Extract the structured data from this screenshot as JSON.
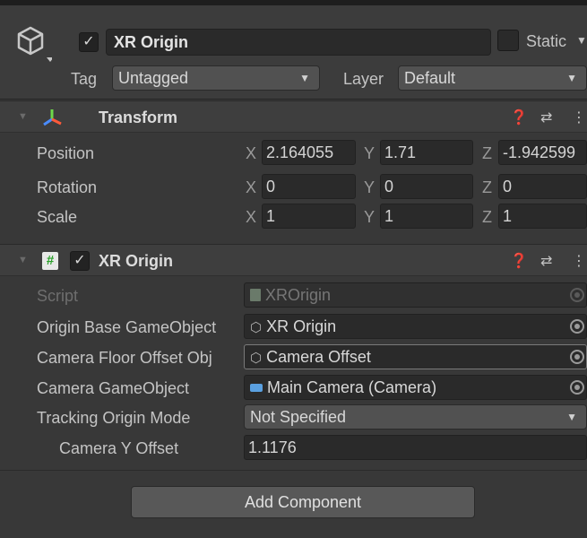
{
  "gameobject": {
    "active_check": "✓",
    "name": "XR Origin",
    "static_label": "Static",
    "tag_label": "Tag",
    "tag_value": "Untagged",
    "layer_label": "Layer",
    "layer_value": "Default"
  },
  "transform": {
    "title": "Transform",
    "position": {
      "label": "Position",
      "x": "2.164055",
      "y": "1.71",
      "z": "-1.942599"
    },
    "rotation": {
      "label": "Rotation",
      "x": "0",
      "y": "0",
      "z": "0"
    },
    "scale": {
      "label": "Scale",
      "x": "1",
      "y": "1",
      "z": "1"
    },
    "axis": {
      "x": "X",
      "y": "Y",
      "z": "Z"
    }
  },
  "xr_origin": {
    "title": "XR Origin",
    "enabled_check": "✓",
    "script_icon": "#",
    "fields": {
      "script": {
        "label": "Script",
        "value": "XROrigin"
      },
      "origin_base": {
        "label": "Origin Base GameObject",
        "value": "XR Origin"
      },
      "camera_floor_offset": {
        "label": "Camera Floor Offset Obj",
        "value": "Camera Offset"
      },
      "camera_gameobject": {
        "label": "Camera GameObject",
        "value": "Main Camera (Camera)"
      },
      "tracking_origin_mode": {
        "label": "Tracking Origin Mode",
        "value": "Not Specified"
      },
      "camera_y_offset": {
        "label": "Camera Y Offset",
        "value": "1.1176"
      }
    }
  },
  "icons": {
    "help": "help-icon",
    "presets": "presets-icon",
    "menu": "kebab-menu-icon",
    "gameobject": "cube-icon",
    "transform": "transform-axes-icon",
    "camera": "camera-icon",
    "object_ref": "gameobject-cube-icon"
  },
  "add_component": {
    "label": "Add Component"
  },
  "colors": {
    "background": "#383838",
    "field": "#2a2a2a",
    "accent_green": "#3fbf3f"
  }
}
